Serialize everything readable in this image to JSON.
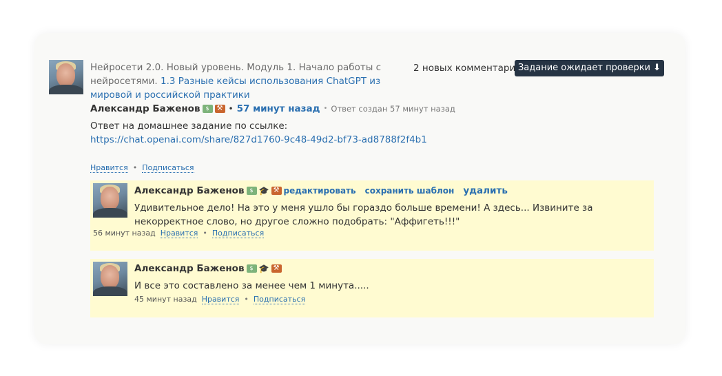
{
  "post": {
    "title_prefix": "Нейросети 2.0. Новый уровень. Модуль 1. Начало работы с нейросетями.",
    "title_link": "1.3 Разные кейсы использования ChatGPT из мировой и российской практики",
    "comments_count": "2 новых комментария",
    "status_button": "Задание ожидает проверки ⬇",
    "author": "Александр Баженов",
    "time": "57 минут назад",
    "created": "Ответ создан 57 минут назад",
    "answer_line1": "Ответ на домашнее задание по ссылке:",
    "answer_url": "https://chat.openai.com/share/827d1760-9c48-49d2-bf73-ad8788f2f4b1",
    "like": "Нравится",
    "subscribe": "Подписаться"
  },
  "comments": [
    {
      "author": "Александр Баженов",
      "edit": "редактировать",
      "save_template": "сохранить шаблон",
      "delete": "удалить",
      "text": "Удивительное дело! На это у меня ушло бы гораздо больше времени! А здесь... Извините за некорректное слово, но другое сложно подобрать: \"Аффигеть!!!\"",
      "time": "56 минут назад",
      "like": "Нравится",
      "subscribe": "Подписаться"
    },
    {
      "author": "Александр Баженов",
      "text": "И все это составлено за менее чем 1 минута.....",
      "time": "45 минут назад",
      "like": "Нравится",
      "subscribe": "Подписаться"
    }
  ],
  "icons": {
    "money": "money-icon",
    "cap": "graduation-cap-icon",
    "hammer": "hammer-icon"
  }
}
